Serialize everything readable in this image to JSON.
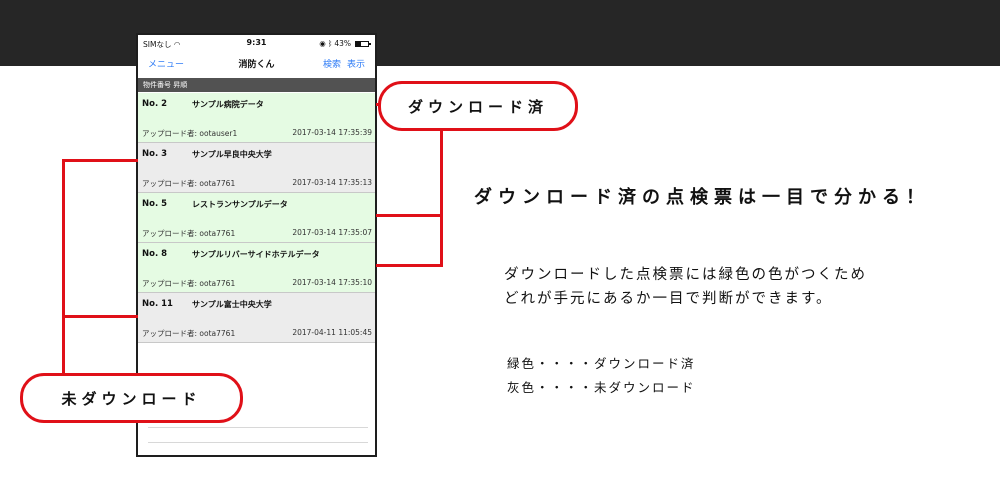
{
  "statusbar": {
    "carrier": "SIMなし",
    "time": "9:31",
    "battery": "43%",
    "battery_level": 0.43
  },
  "navbar": {
    "menu": "メニュー",
    "title": "消防くん",
    "search": "検索",
    "display": "表示"
  },
  "sortbar": {
    "label": "物件番号 昇順"
  },
  "rows": [
    {
      "no": "No. 2",
      "name": "サンプル病院データ",
      "uploader": "アップロード者: ootauser1",
      "date": "2017-03-14 17:35:39",
      "status": "downloaded"
    },
    {
      "no": "No. 3",
      "name": "サンプル早良中央大学",
      "uploader": "アップロード者: oota7761",
      "date": "2017-03-14 17:35:13",
      "status": "not-downloaded"
    },
    {
      "no": "No. 5",
      "name": "レストランサンプルデータ",
      "uploader": "アップロード者: oota7761",
      "date": "2017-03-14 17:35:07",
      "status": "downloaded"
    },
    {
      "no": "No. 8",
      "name": "サンプルリバーサイドホテルデータ",
      "uploader": "アップロード者: oota7761",
      "date": "2017-03-14 17:35:10",
      "status": "downloaded"
    },
    {
      "no": "No. 11",
      "name": "サンプル富士中央大学",
      "uploader": "アップロード者: oota7761",
      "date": "2017-04-11 11:05:45",
      "status": "not-downloaded"
    }
  ],
  "callouts": {
    "downloaded": "ダウンロード済",
    "not_downloaded": "未ダウンロード"
  },
  "headline": "ダウンロード済の点検票は一目で分かる！",
  "description": {
    "line1": "ダウンロードした点検票には緑色の色がつくため",
    "line2": "どれが手元にあるか一目で判断ができます。"
  },
  "legend": {
    "green": "緑色・・・・ダウンロード済",
    "gray": "灰色・・・・未ダウンロード"
  },
  "colors": {
    "accent": "#e01018",
    "downloaded_row": "#e5fbe3",
    "not_downloaded_row": "#ececec",
    "link": "#2f7cf6"
  }
}
